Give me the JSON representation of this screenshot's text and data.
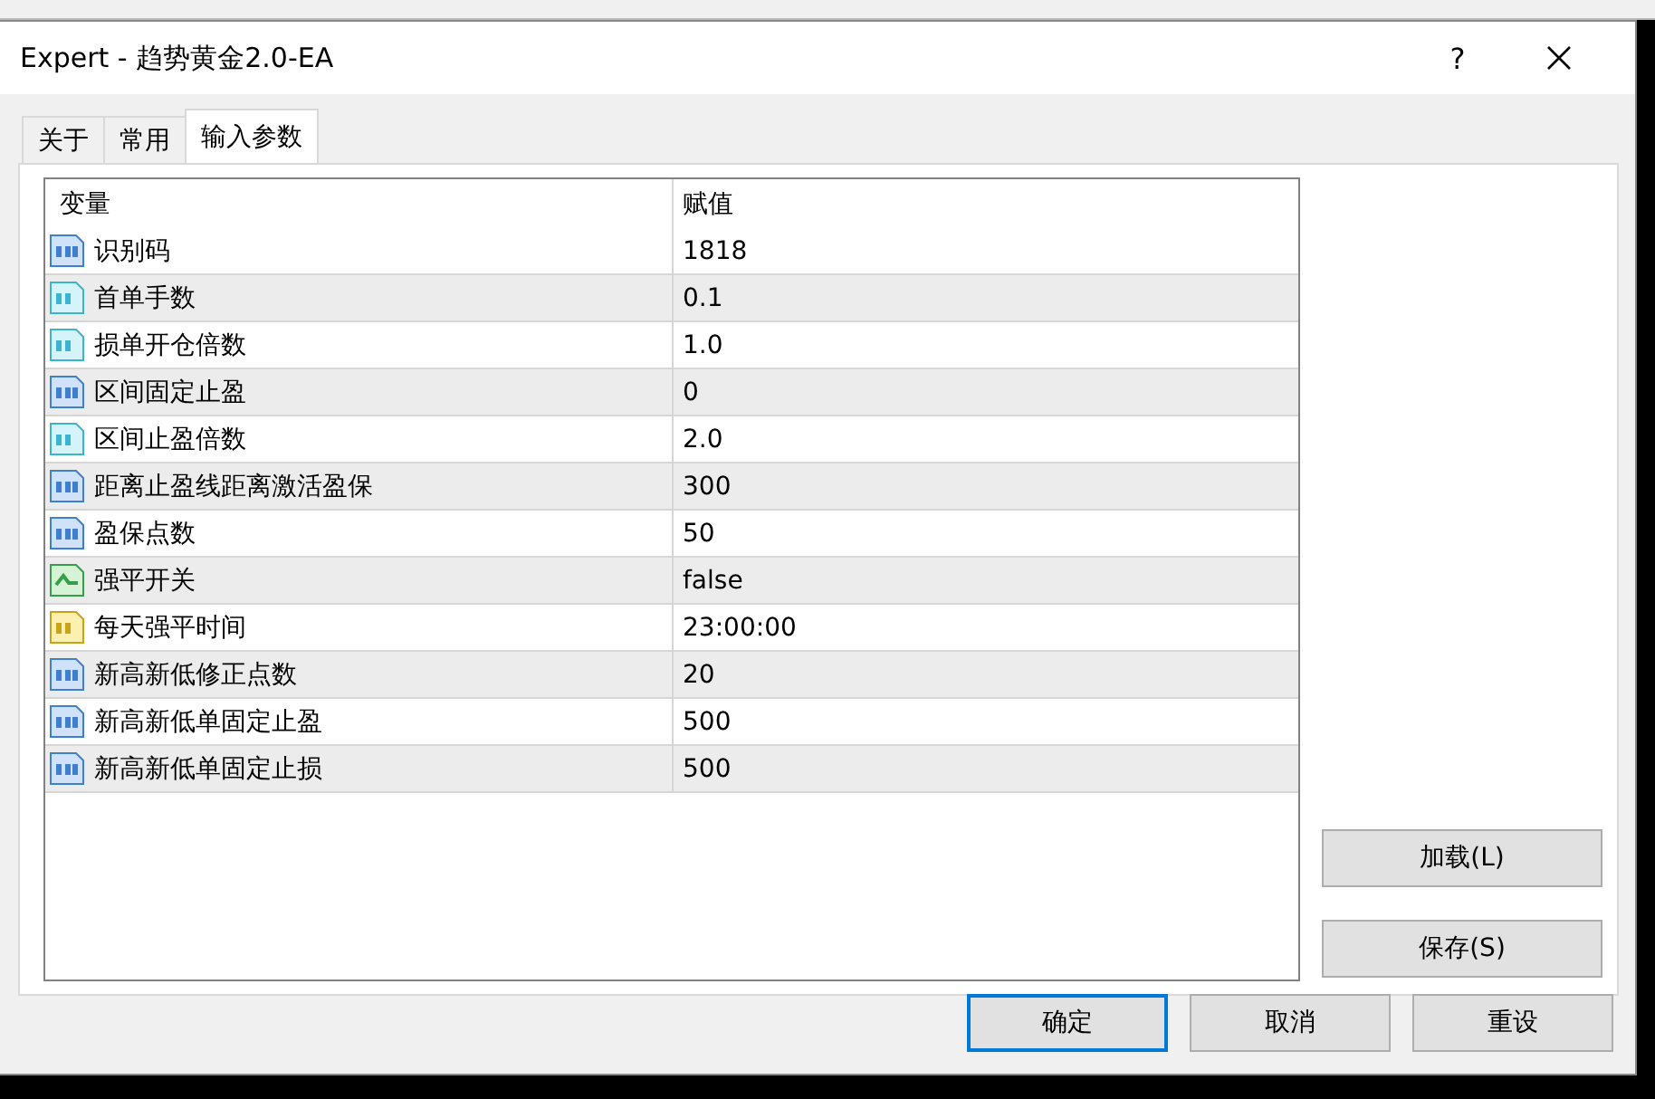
{
  "window": {
    "title": "Expert - 趋势黄金2.0-EA",
    "help": "?"
  },
  "tabs": [
    {
      "label": "关于",
      "selected": false
    },
    {
      "label": "常用",
      "selected": false
    },
    {
      "label": "输入参数",
      "selected": true
    }
  ],
  "table": {
    "columns": [
      "变量",
      "赋值"
    ],
    "rows": [
      {
        "kind": "int",
        "name": "识别码",
        "value": "1818"
      },
      {
        "kind": "double",
        "name": "首单手数",
        "value": "0.1"
      },
      {
        "kind": "double",
        "name": "损单开仓倍数",
        "value": "1.0"
      },
      {
        "kind": "int",
        "name": "区间固定止盈",
        "value": "0"
      },
      {
        "kind": "double",
        "name": "区间止盈倍数",
        "value": "2.0"
      },
      {
        "kind": "int",
        "name": "距离止盈线距离激活盈保",
        "value": "300"
      },
      {
        "kind": "int",
        "name": "盈保点数",
        "value": "50"
      },
      {
        "kind": "bool",
        "name": "强平开关",
        "value": "false"
      },
      {
        "kind": "string",
        "name": "每天强平时间",
        "value": "23:00:00"
      },
      {
        "kind": "int",
        "name": "新高新低修正点数",
        "value": "20"
      },
      {
        "kind": "int",
        "name": "新高新低单固定止盈",
        "value": "500"
      },
      {
        "kind": "int",
        "name": "新高新低单固定止损",
        "value": "500"
      }
    ]
  },
  "side_buttons": [
    "加载(L)",
    "保存(S)"
  ],
  "buttons": [
    {
      "label": "确定",
      "default": true
    },
    {
      "label": "取消",
      "default": false
    },
    {
      "label": "重设",
      "default": false
    }
  ]
}
